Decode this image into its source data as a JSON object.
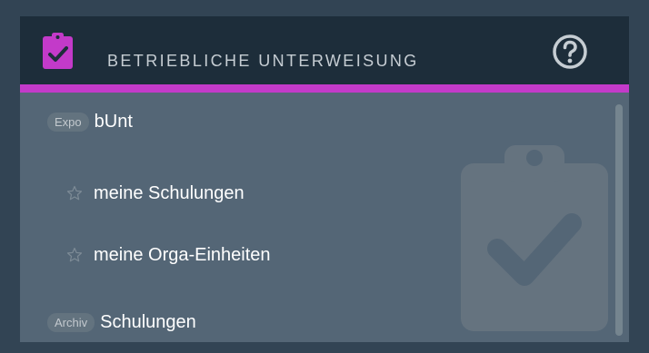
{
  "header": {
    "title": "BETRIEBLICHE UNTERWEISUNG",
    "icon": "clipboard-check-icon",
    "help_icon": "question-circle-icon"
  },
  "colors": {
    "accent": "#c33ac9",
    "header_bg": "#1d2d3a",
    "body_bg": "#546676",
    "page_bg": "#324454"
  },
  "list": {
    "items": [
      {
        "badge": "Expo",
        "label": "bUnt"
      },
      {
        "icon": "star-outline-icon",
        "label": "meine Schulungen"
      },
      {
        "icon": "star-outline-icon",
        "label": "meine Orga-Einheiten"
      },
      {
        "badge": "Archiv",
        "label": "Schulungen"
      }
    ]
  }
}
